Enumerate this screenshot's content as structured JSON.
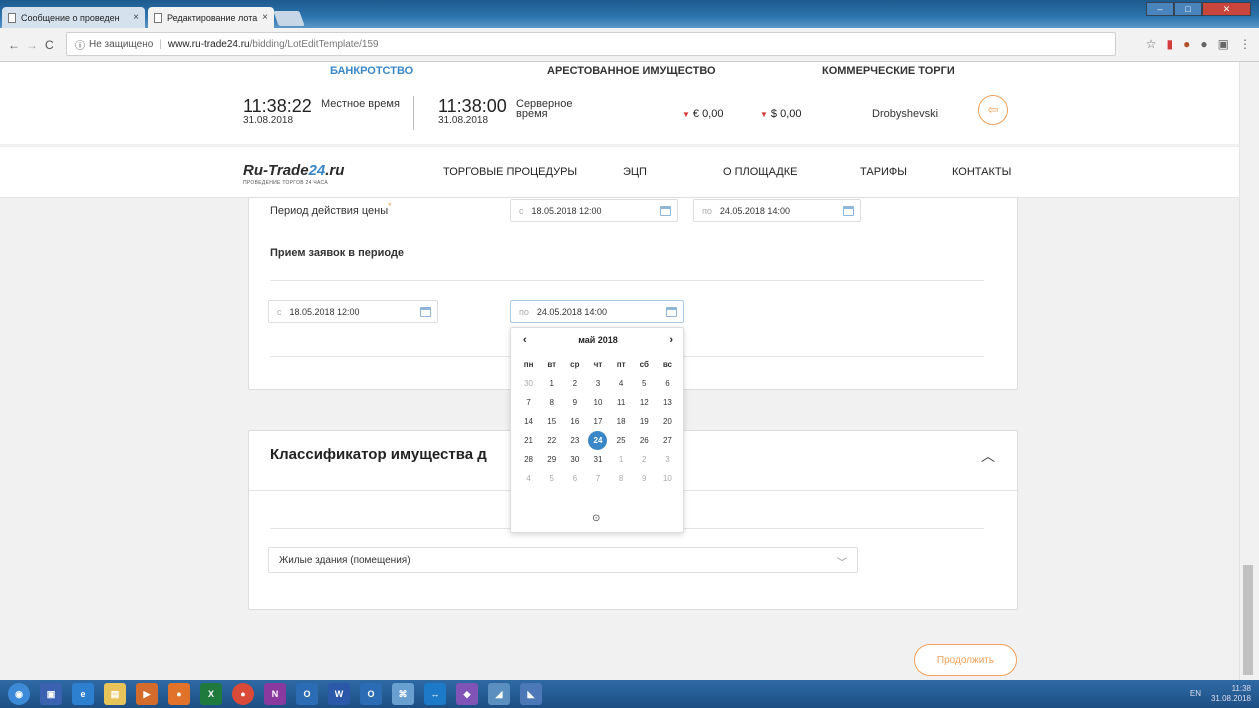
{
  "browser": {
    "tabs": [
      {
        "label": "Сообщение о проведен"
      },
      {
        "label": "Редактирование лота"
      }
    ],
    "url_info": "ⓘ",
    "url_security": "Не защищено",
    "url_host": "www.ru-trade24.ru",
    "url_path": "/bidding/LotEditTemplate/159",
    "close_glyph": "×"
  },
  "section_tabs": [
    "БАНКРОТСТВО",
    "АРЕСТОВАННОЕ ИМУЩЕСТВО",
    "КОММЕРЧЕСКИЕ ТОРГИ"
  ],
  "clocks": {
    "local": {
      "time": "11:38:22",
      "date": "31.08.2018",
      "label": "Местное время"
    },
    "server": {
      "time": "11:38:00",
      "date": "31.08.2018",
      "label1": "Серверное",
      "label2": "время"
    }
  },
  "balances": {
    "eur": "€ 0,00",
    "usd": "$ 0,00"
  },
  "user": {
    "name": "Drobyshevski"
  },
  "logo": {
    "text": "Ru-Trade",
    "num": "24",
    "domain": ".ru",
    "sub": "ПРОВЕДЕНИЕ ТОРГОВ   24 ЧАСА"
  },
  "menu": [
    "ТОРГОВЫЕ ПРОЦЕДУРЫ",
    "ЭЦП",
    "О ПЛОЩАДКЕ",
    "ТАРИФЫ",
    "КОНТАКТЫ"
  ],
  "price_period": {
    "label": "Период действия цены",
    "req": "*",
    "from_prefix": "с",
    "from": "18.05.2018 12:00",
    "to_prefix": "по",
    "to": "24.05.2018 14:00"
  },
  "apps_period": {
    "title": "Прием заявок в периоде",
    "from_prefix": "с",
    "from": "18.05.2018 12:00",
    "to_prefix": "по",
    "to": "24.05.2018 14:00"
  },
  "datepicker": {
    "month": "май 2018",
    "prev": "‹",
    "next": "›",
    "dow": [
      "пн",
      "вт",
      "ср",
      "чт",
      "пт",
      "сб",
      "вс"
    ],
    "weeks": [
      [
        "30",
        "1",
        "2",
        "3",
        "4",
        "5",
        "6"
      ],
      [
        "7",
        "8",
        "9",
        "10",
        "11",
        "12",
        "13"
      ],
      [
        "14",
        "15",
        "16",
        "17",
        "18",
        "19",
        "20"
      ],
      [
        "21",
        "22",
        "23",
        "24",
        "25",
        "26",
        "27"
      ],
      [
        "28",
        "29",
        "30",
        "31",
        "1",
        "2",
        "3"
      ],
      [
        "4",
        "5",
        "6",
        "7",
        "8",
        "9",
        "10"
      ]
    ],
    "selected": "24"
  },
  "classifier": {
    "title": "Классификатор имущества д",
    "value": "Жилые здания (помещения)"
  },
  "continue_label": "Продолжить",
  "tray": {
    "lang": "EN",
    "time": "11:38",
    "date": "31.08.2018"
  }
}
